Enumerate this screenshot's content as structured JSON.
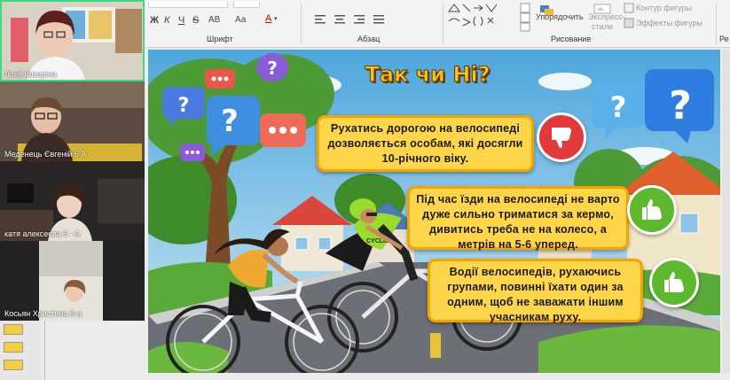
{
  "participants": [
    {
      "name": "Лілія Казаріна",
      "active": true
    },
    {
      "name": "Меденець Євгеній 6 А"
    },
    {
      "name": "катя алексеєва 6 - А"
    },
    {
      "name": "Косьян Христина 6-а"
    }
  ],
  "ribbon": {
    "font_group": "Шрифт",
    "paragraph_group": "Абзац",
    "drawing_group": "Рисование",
    "editing_group_partial": "Ре",
    "arrange_label": "Упорядочить",
    "quick_styles_line1": "Экспресс-",
    "quick_styles_line2": "стили",
    "shape_outline": "Контур фигуры",
    "shape_effects": "Эффекты фигуры",
    "bold": "Ж",
    "italic": "К",
    "underline": "Ч",
    "strike": "S",
    "spacing": "АВ",
    "case": "Аа",
    "font_color": "А"
  },
  "slide": {
    "title": "Так чи Ні?",
    "statements": [
      {
        "text": "Рухатись дорогою на велосипеді дозволяється особам, які досягли 10-річного віку.",
        "verdict": "no",
        "icon": "thumbs-down-icon"
      },
      {
        "text": "Під час їзди на велосипеді не варто дуже сильно триматися за кермо, дивитись треба не на колесо, а метрів на 5-6 уперед.",
        "verdict": "yes",
        "icon": "thumbs-up-icon"
      },
      {
        "text": "Водії велосипедів, рухаючись групами, повинні їхати один за одним, щоб не заважати іншим учасникам руху.",
        "verdict": "yes",
        "icon": "thumbs-up-icon"
      }
    ],
    "jersey_text": "CYCLIST"
  },
  "colors": {
    "title": "#ffc21a",
    "statement_bg": "#ffd64a",
    "statement_border": "#f4a300",
    "no": "#e23a3a",
    "yes": "#5cb82c",
    "active_speaker": "#3ddc84"
  }
}
